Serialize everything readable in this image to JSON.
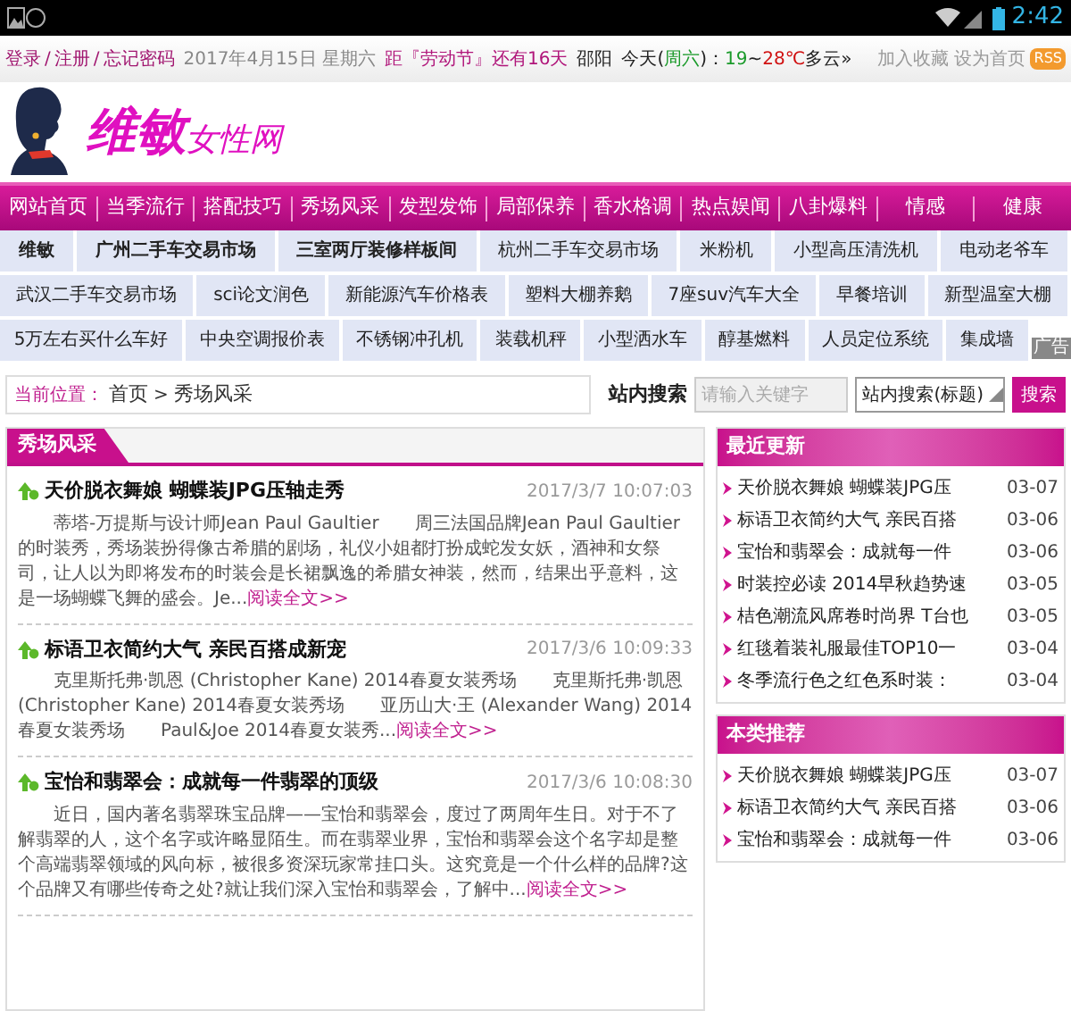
{
  "status_bar": {
    "time": "2:42"
  },
  "top_bar": {
    "account_links": [
      "登录",
      "注册",
      "忘记密码"
    ],
    "separator": "/",
    "date": "2017年4月15日 星期六",
    "countdown": "距『劳动节』还有16天",
    "city": "邵阳",
    "weather": [
      {
        "text": "今天(",
        "color": "#222222"
      },
      {
        "text": "周六",
        "color": "#1a9a2a"
      },
      {
        "text": ")：",
        "color": "#222222"
      },
      {
        "text": "19",
        "color": "#1a9a2a"
      },
      {
        "text": "~",
        "color": "#222222"
      },
      {
        "text": "28℃",
        "color": "#d01010"
      },
      {
        "text": "多云",
        "color": "#222222"
      },
      {
        "text": "»",
        "color": "#222222"
      }
    ],
    "right_links": [
      "加入收藏",
      "设为首页"
    ],
    "rss": "RSS"
  },
  "logo": {
    "main": "维敏",
    "sub": "女性网"
  },
  "nav": [
    {
      "label": "网站首页",
      "selected": false
    },
    {
      "label": "当季流行",
      "selected": false
    },
    {
      "label": "搭配技巧",
      "selected": false
    },
    {
      "label": "秀场风采",
      "selected": false
    },
    {
      "label": "发型发饰",
      "selected": false
    },
    {
      "label": "局部保养",
      "selected": false
    },
    {
      "label": "香水格调",
      "selected": false
    },
    {
      "label": "热点娱闻",
      "selected": false
    },
    {
      "label": "八卦爆料",
      "selected": false
    },
    {
      "label": "情感",
      "selected": false
    },
    {
      "label": "健康",
      "selected": false
    }
  ],
  "ad_links": [
    [
      {
        "label": "维敏",
        "bold": true
      },
      {
        "label": "广州二手车交易市场",
        "bold": true
      },
      {
        "label": "三室两厅装修样板间",
        "bold": true
      },
      {
        "label": "杭州二手车交易市场",
        "bold": false
      },
      {
        "label": "米粉机",
        "bold": false
      },
      {
        "label": "小型高压清洗机",
        "bold": false
      },
      {
        "label": "电动老爷车",
        "bold": false
      }
    ],
    [
      {
        "label": "武汉二手车交易市场",
        "bold": false
      },
      {
        "label": "sci论文润色",
        "bold": false
      },
      {
        "label": "新能源汽车价格表",
        "bold": false
      },
      {
        "label": "塑料大棚养鹅",
        "bold": false
      },
      {
        "label": "7座suv汽车大全",
        "bold": false
      },
      {
        "label": "早餐培训",
        "bold": false
      },
      {
        "label": "新型温室大棚",
        "bold": false
      }
    ],
    [
      {
        "label": "5万左右买什么车好",
        "bold": false
      },
      {
        "label": "中央空调报价表",
        "bold": false
      },
      {
        "label": "不锈钢冲孔机",
        "bold": false
      },
      {
        "label": "装载机秤",
        "bold": false
      },
      {
        "label": "小型洒水车",
        "bold": false
      },
      {
        "label": "醇基燃料",
        "bold": false
      },
      {
        "label": "人员定位系统",
        "bold": false
      },
      {
        "label": "集成墙",
        "bold": false
      }
    ]
  ],
  "ad_badge": "广告",
  "breadcrumb": {
    "label": "当前位置：",
    "items": [
      "首页",
      "秀场风采"
    ],
    "separator": ">"
  },
  "search": {
    "label": "站内搜索",
    "placeholder": "请输入关键字",
    "scope": "站内搜索(标题)",
    "button": "搜索"
  },
  "section": {
    "title": "秀场风采",
    "articles": [
      {
        "title": "天价脱衣舞娘 蝴蝶装JPG压轴走秀",
        "date": "2017/3/7 10:07:03",
        "summary": "蒂塔-万提斯与设计师Jean Paul Gaultier　　周三法国品牌Jean Paul Gaultier的时装秀，秀场装扮得像古希腊的剧场，礼仪小姐都打扮成蛇发女妖，酒神和女祭司，让人以为即将发布的时装会是长裙飘逸的希腊女神装，然而，结果出乎意料，这是一场蝴蝶飞舞的盛会。Je...",
        "more": "阅读全文>>"
      },
      {
        "title": "标语卫衣简约大气 亲民百搭成新宠",
        "date": "2017/3/6 10:09:33",
        "summary": "克里斯托弗·凯恩 (Christopher Kane) 2014春夏女装秀场　　克里斯托弗·凯恩 (Christopher Kane) 2014春夏女装秀场　　亚历山大·王 (Alexander Wang) 2014春夏女装秀场　　Paul&Joe 2014春夏女装秀...",
        "more": "阅读全文>>"
      },
      {
        "title": "宝怡和翡翠会：成就每一件翡翠的顶级",
        "date": "2017/3/6 10:08:30",
        "summary": "近日，国内著名翡翠珠宝品牌——宝怡和翡翠会，度过了两周年生日。对于不了解翡翠的人，这个名字或许略显陌生。而在翡翠业界，宝怡和翡翠会这个名字却是整个高端翡翠领域的风向标，被很多资深玩家常挂口头。这究竟是一个什么样的品牌?这个品牌又有哪些传奇之处?就让我们深入宝怡和翡翠会，了解中...",
        "more": "阅读全文>>"
      }
    ]
  },
  "sidebar": [
    {
      "title": "最近更新",
      "items": [
        {
          "title": "天价脱衣舞娘 蝴蝶装JPG压",
          "date": "03-07"
        },
        {
          "title": "标语卫衣简约大气 亲民百搭",
          "date": "03-06"
        },
        {
          "title": "宝怡和翡翠会：成就每一件",
          "date": "03-06"
        },
        {
          "title": "时装控必读 2014早秋趋势速",
          "date": "03-05"
        },
        {
          "title": "桔色潮流风席卷时尚界 T台也",
          "date": "03-05"
        },
        {
          "title": "红毯着装礼服最佳TOP10一",
          "date": "03-04"
        },
        {
          "title": "冬季流行色之红色系时装：",
          "date": "03-04"
        }
      ]
    },
    {
      "title": "本类推荐",
      "items": [
        {
          "title": "天价脱衣舞娘 蝴蝶装JPG压",
          "date": "03-07"
        },
        {
          "title": "标语卫衣简约大气 亲民百搭",
          "date": "03-06"
        },
        {
          "title": "宝怡和翡翠会：成就每一件",
          "date": "03-06"
        }
      ]
    }
  ]
}
